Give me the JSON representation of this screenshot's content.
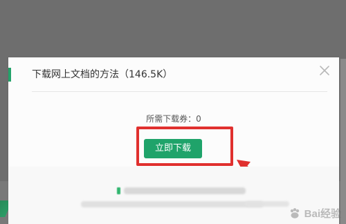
{
  "dialog": {
    "title": "下载网上文档的方法（146.5K）",
    "coupon_text": "所需下载券：0",
    "download_button_label": "立即下载"
  },
  "icons": {
    "close": "close-icon",
    "watermark": "baidu-paw-icon"
  },
  "watermark": {
    "label": "Bai经验"
  },
  "colors": {
    "accent": "#23a36a",
    "highlight": "#e0302e",
    "backdrop": "#6e6e6e"
  }
}
